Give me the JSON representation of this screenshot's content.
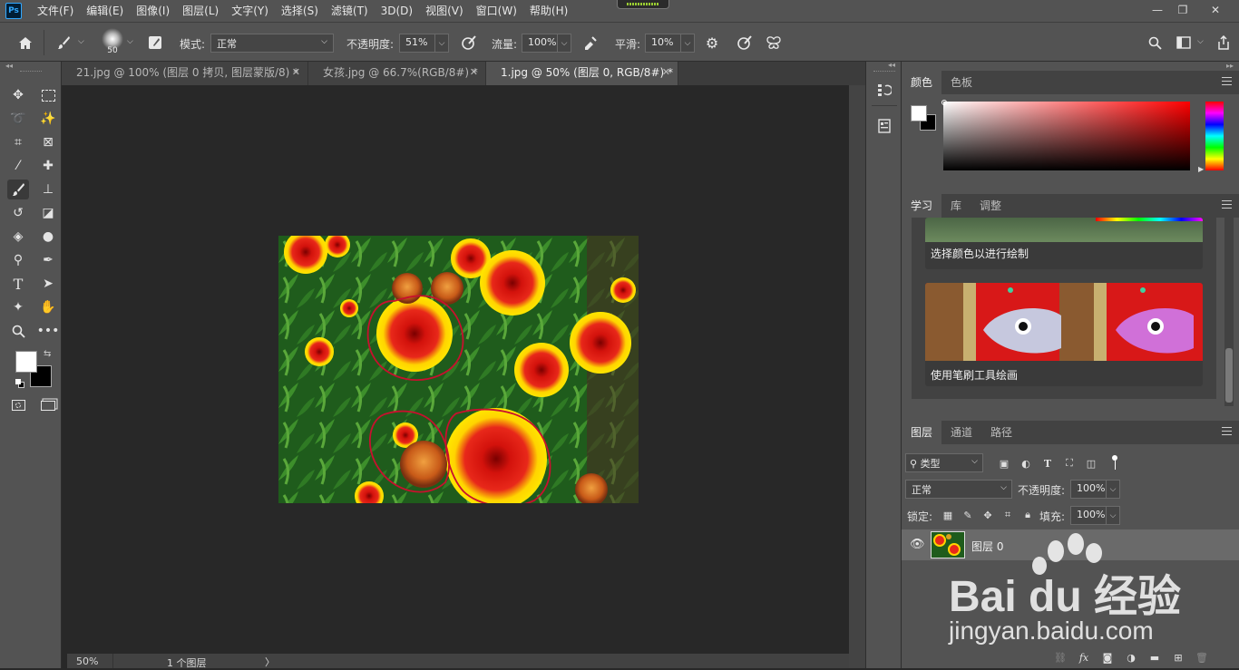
{
  "app": {
    "logo": "Ps"
  },
  "menu": [
    "文件(F)",
    "编辑(E)",
    "图像(I)",
    "图层(L)",
    "文字(Y)",
    "选择(S)",
    "滤镜(T)",
    "3D(D)",
    "视图(V)",
    "窗口(W)",
    "帮助(H)"
  ],
  "window_controls": {
    "minimize": "—",
    "restore": "❐",
    "close": "✕"
  },
  "options": {
    "brush_size": "50",
    "mode_label": "模式:",
    "mode_value": "正常",
    "opacity_label": "不透明度:",
    "opacity_value": "51%",
    "flow_label": "流量:",
    "flow_value": "100%",
    "smooth_label": "平滑:",
    "smooth_value": "10%"
  },
  "tabs": [
    {
      "label": "21.jpg @ 100% (图层 0 拷贝, 图层蒙版/8) *",
      "active": false
    },
    {
      "label": "女孩.jpg @ 66.7%(RGB/8#) *",
      "active": false
    },
    {
      "label": "1.jpg @ 50% (图层 0, RGB/8#) *",
      "active": true
    }
  ],
  "status": {
    "zoom": "50%",
    "info": "1 个图层",
    "arrow": "〉"
  },
  "color_panel": {
    "tabs": [
      "颜色",
      "色板"
    ],
    "active": "颜色",
    "hue": "#ff0000"
  },
  "learn_panel": {
    "tabs": [
      "学习",
      "库",
      "调整"
    ],
    "active": "学习",
    "cards": [
      {
        "title": "选择颜色以进行绘制"
      },
      {
        "title": "使用笔刷工具绘画"
      }
    ]
  },
  "layers_panel": {
    "tabs": [
      "图层",
      "通道",
      "路径"
    ],
    "active": "图层",
    "filter_label": "类型",
    "blend_mode": "正常",
    "opacity_label": "不透明度:",
    "opacity_value": "100%",
    "lock_label": "锁定:",
    "fill_label": "填充:",
    "fill_value": "100%",
    "layers": [
      {
        "name": "图层 0",
        "visible": true
      }
    ]
  },
  "watermark": {
    "brand": "Bai du 经验",
    "url": "jingyan.baidu.com"
  },
  "colors": {
    "accent": "#31a8ff",
    "bg": "#535353",
    "canvas": "#282828",
    "annotation": "#c8102e"
  }
}
